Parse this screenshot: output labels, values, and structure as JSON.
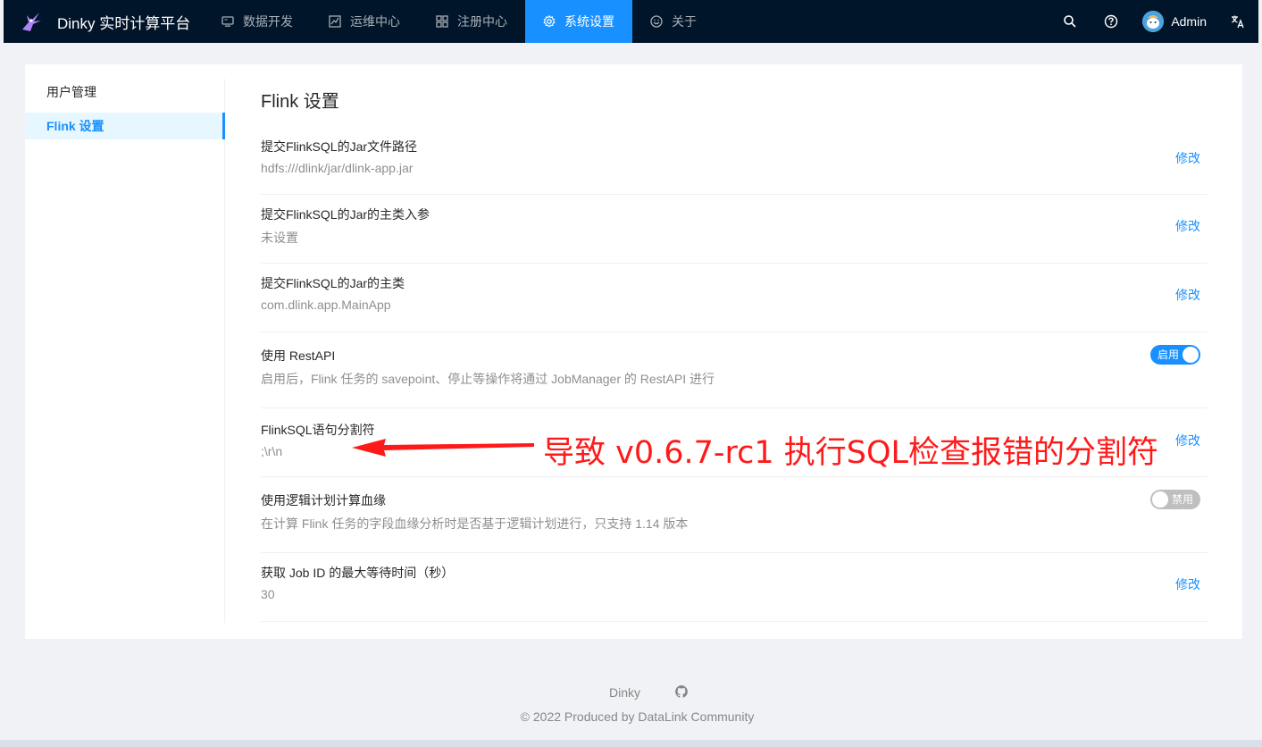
{
  "header": {
    "title": "Dinky 实时计算平台",
    "nav": [
      {
        "label": "数据开发",
        "icon": "desktop-icon"
      },
      {
        "label": "运维中心",
        "icon": "fund-icon"
      },
      {
        "label": "注册中心",
        "icon": "appstore-icon"
      },
      {
        "label": "系统设置",
        "icon": "setting-icon",
        "active": true
      },
      {
        "label": "关于",
        "icon": "smile-icon"
      }
    ],
    "user": "Admin"
  },
  "sidebar": {
    "items": [
      {
        "label": "用户管理"
      },
      {
        "label": "Flink 设置",
        "active": true
      }
    ]
  },
  "main": {
    "title": "Flink 设置",
    "rows": [
      {
        "title": "提交FlinkSQL的Jar文件路径",
        "desc": "hdfs:///dlink/jar/dlink-app.jar",
        "action": "修改"
      },
      {
        "title": "提交FlinkSQL的Jar的主类入参",
        "desc": "未设置",
        "action": "修改"
      },
      {
        "title": "提交FlinkSQL的Jar的主类",
        "desc": "com.dlink.app.MainApp",
        "action": "修改"
      },
      {
        "title": "使用 RestAPI",
        "desc": "启用后，Flink 任务的 savepoint、停止等操作将通过 JobManager 的 RestAPI 进行",
        "switch_label": "启用",
        "switch_on": true
      },
      {
        "title": "FlinkSQL语句分割符",
        "desc": ";\\r\\n",
        "action": "修改"
      },
      {
        "title": "使用逻辑计划计算血缘",
        "desc": "在计算 Flink 任务的字段血缘分析时是否基于逻辑计划进行，只支持 1.14 版本",
        "switch_label": "禁用",
        "switch_on": false
      },
      {
        "title": "获取 Job ID 的最大等待时间（秒）",
        "desc": "30",
        "action": "修改"
      }
    ]
  },
  "annotation": {
    "text": "导致 v0.6.7-rc1 执行SQL检查报错的分割符",
    "color": "#ff1a1a"
  },
  "footer": {
    "link": "Dinky",
    "copyright": "2022 Produced by DataLink Community"
  },
  "colors": {
    "header_bg": "#001529",
    "primary": "#1890ff"
  }
}
